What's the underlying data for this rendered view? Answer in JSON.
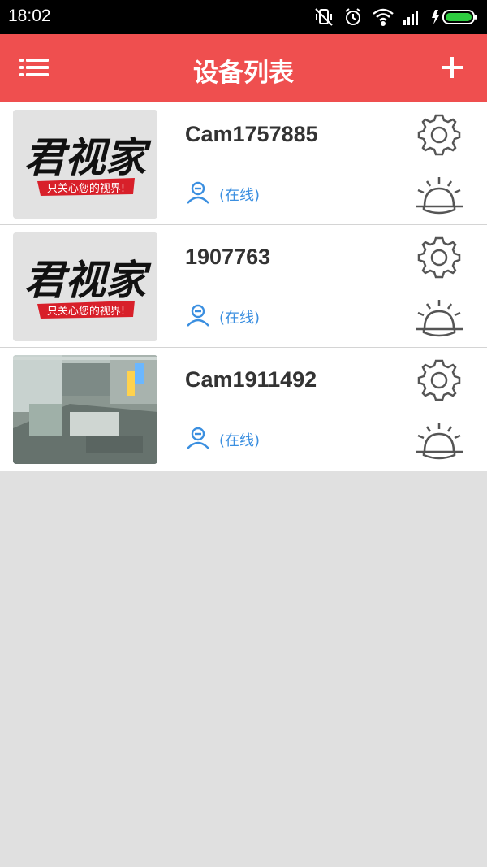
{
  "status_bar": {
    "time": "18:02",
    "icons": [
      "vibrate-icon",
      "alarm-clock-icon",
      "wifi-icon",
      "signal-icon",
      "battery-charging-icon"
    ]
  },
  "app_bar": {
    "title": "设备列表",
    "menu_icon": "menu-icon",
    "add_icon": "plus-icon"
  },
  "devices": [
    {
      "name": "Cam1757885",
      "status": "(在线)",
      "thumbnail": "logo",
      "logo_text": "君视家",
      "logo_slogan": "只关心您的视界!"
    },
    {
      "name": "1907763",
      "status": "(在线)",
      "thumbnail": "logo",
      "logo_text": "君视家",
      "logo_slogan": "只关心您的视界!"
    },
    {
      "name": "Cam1911492",
      "status": "(在线)",
      "thumbnail": "office-camera-snapshot"
    }
  ],
  "colors": {
    "app_bar": "#ef4f4f",
    "status_text": "#3b8fe0",
    "background": "#e0e0e0"
  }
}
